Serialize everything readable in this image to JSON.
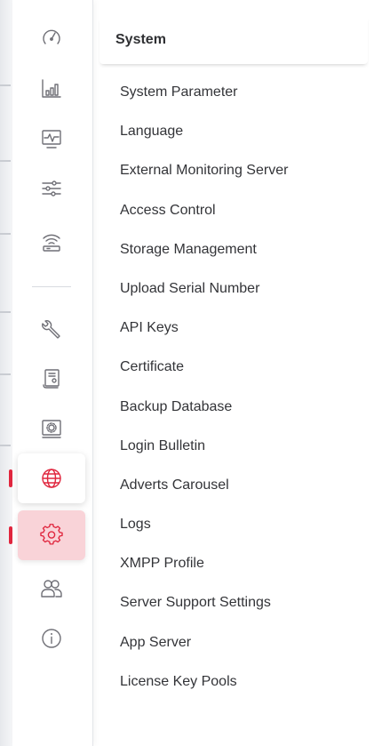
{
  "rail": {
    "items": [
      {
        "name": "dashboard-icon",
        "icon": "speedometer"
      },
      {
        "name": "statistics-icon",
        "icon": "bar-chart"
      },
      {
        "name": "monitor-icon",
        "icon": "heartbeat-monitor"
      },
      {
        "name": "settings-sliders-icon",
        "icon": "sliders"
      },
      {
        "name": "router-icon",
        "icon": "wifi-router"
      },
      {
        "name": "tools-icon",
        "icon": "wrench"
      },
      {
        "name": "report-icon",
        "icon": "document"
      },
      {
        "name": "device-config-icon",
        "icon": "screen-gear"
      },
      {
        "name": "globe-icon",
        "icon": "globe"
      },
      {
        "name": "gear-icon",
        "icon": "gear"
      },
      {
        "name": "users-icon",
        "icon": "users"
      },
      {
        "name": "info-icon",
        "icon": "info"
      }
    ],
    "accent_color": "#e0263e",
    "active_bg": "#f9d3d8"
  },
  "submenu": {
    "title": "System",
    "items": [
      "System Parameter",
      "Language",
      "External Monitoring Server",
      "Access Control",
      "Storage Management",
      "Upload Serial Number",
      "API Keys",
      "Certificate",
      "Backup Database",
      "Login Bulletin",
      "Adverts Carousel",
      "Logs",
      "XMPP Profile",
      "Server Support Settings",
      "App Server",
      "License Key Pools"
    ]
  }
}
